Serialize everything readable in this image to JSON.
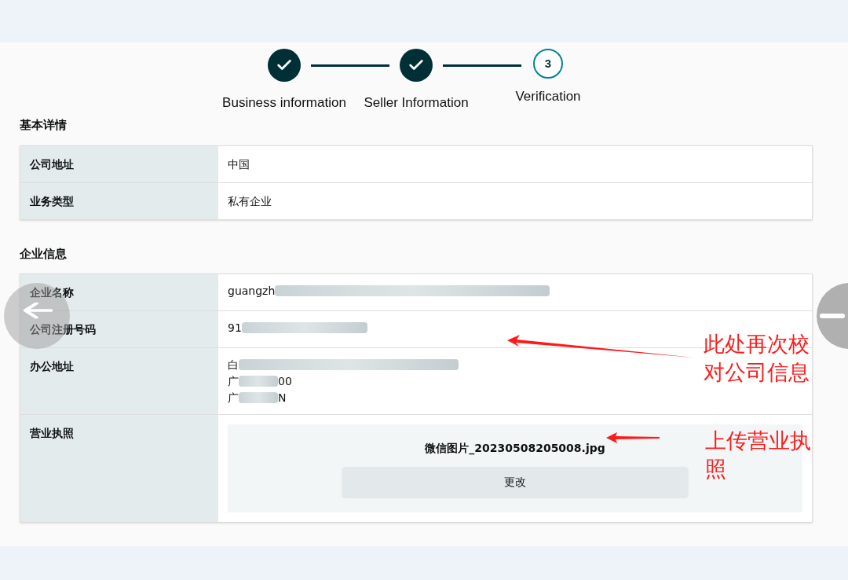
{
  "stepper": {
    "steps": [
      {
        "label": "Business information",
        "completed": true
      },
      {
        "label": "Seller Information",
        "completed": true
      },
      {
        "label": "Verification",
        "completed": false,
        "number": "3"
      }
    ]
  },
  "sections": [
    {
      "title": "基本详情",
      "rows": [
        {
          "kind": "text",
          "label": "公司地址",
          "value": "中国"
        },
        {
          "kind": "text",
          "label": "业务类型",
          "value": "私有企业"
        }
      ]
    },
    {
      "title": "企业信息",
      "rows": [
        {
          "kind": "redacted",
          "label": "企业名称",
          "lines": [
            [
              "guangzh"
            ]
          ]
        },
        {
          "kind": "redacted",
          "label": "公司注册号码",
          "lines": [
            [
              "91"
            ]
          ]
        },
        {
          "kind": "redacted",
          "label": "办公地址",
          "lines": [
            [
              "白"
            ],
            [
              "广",
              "00"
            ],
            [
              "广",
              "N"
            ]
          ]
        },
        {
          "kind": "upload",
          "label": "营业执照",
          "file": "微信图片_20230508205008.jpg",
          "button": "更改"
        }
      ]
    }
  ],
  "annotations": [
    {
      "text": "此处再次校对公司信息"
    },
    {
      "text": "上传营业执照"
    }
  ]
}
